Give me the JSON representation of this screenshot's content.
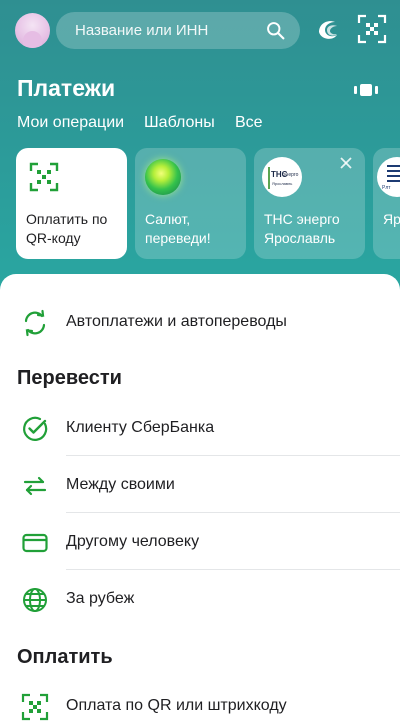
{
  "header": {
    "avatar_icon": "profile-avatar",
    "search": {
      "placeholder": "Название или ИНН",
      "icon": "search-icon"
    },
    "icons": [
      "salut-assistant-icon",
      "qr-scan-icon"
    ]
  },
  "page": {
    "title": "Платежи",
    "view_toggle_icon": "view-toggle-icon",
    "tabs": [
      {
        "label": "Мои операции"
      },
      {
        "label": "Шаблоны"
      },
      {
        "label": "Все"
      }
    ]
  },
  "cards": [
    {
      "label": "Оплатить по QR-коду",
      "icon": "qr-icon"
    },
    {
      "label": "Салют, переведи!",
      "icon": "salut-orb-icon"
    },
    {
      "label": "ТНС энерго Ярославль",
      "icon": "tns-logo-icon",
      "logo_text": "ТНС",
      "logo_text2": "энерго",
      "logo_text3": "Ярославль",
      "close_icon": "close-icon"
    },
    {
      "label": "Яр",
      "icon": "company-logo-icon",
      "logo_text": "Рлт"
    }
  ],
  "list": {
    "autopay": {
      "label": "Автоплатежи и автопереводы",
      "icon": "refresh-icon"
    },
    "transfer_section": "Перевести",
    "transfer_items": [
      {
        "label": "Клиенту СберБанка",
        "icon": "check-circle-icon"
      },
      {
        "label": "Между своими",
        "icon": "arrows-swap-icon"
      },
      {
        "label": "Другому человеку",
        "icon": "card-icon"
      },
      {
        "label": "За рубеж",
        "icon": "globe-icon"
      }
    ],
    "pay_section": "Оплатить",
    "pay_items": [
      {
        "label": "Оплата по QR или штрихкоду",
        "icon": "qr-icon"
      }
    ]
  },
  "colors": {
    "accent": "#21a038",
    "header_bg": "#2aa39f",
    "text": "#1f1f22"
  }
}
